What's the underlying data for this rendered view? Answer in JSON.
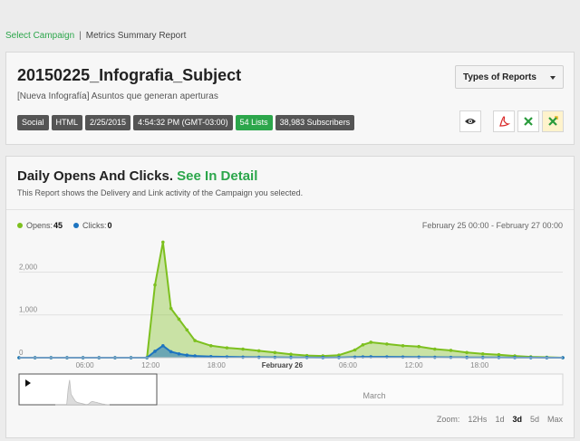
{
  "breadcrumb": {
    "link": "Select Campaign",
    "separator": "|",
    "current": "Metrics Summary Report"
  },
  "campaign": {
    "title": "20150225_Infografia_Subject",
    "subtitle": "[Nueva Infografía] Asuntos que generan aperturas",
    "tags": [
      {
        "label": "Social",
        "style": "dark"
      },
      {
        "label": "HTML",
        "style": "dark"
      },
      {
        "label": "2/25/2015",
        "style": "dark"
      },
      {
        "label": "4:54:32 PM (GMT-03:00)",
        "style": "dark"
      },
      {
        "label": "54 Lists",
        "style": "green"
      },
      {
        "label": "38,983 Subscribers",
        "style": "dark"
      }
    ],
    "reports_button": "Types of Reports",
    "actions": [
      {
        "icon": "eye-icon"
      },
      {
        "icon": "pdf-icon"
      },
      {
        "icon": "excel-icon"
      },
      {
        "icon": "excel-yellow-icon"
      }
    ]
  },
  "chart_section": {
    "title": "Daily Opens And Clicks.",
    "detail_link": "See In Detail",
    "description": "This Report shows the Delivery and Link activity of the Campaign you selected.",
    "date_range": "February 25 00:00 - February 27 00:00",
    "legend": [
      {
        "label": "Opens:",
        "value": "45",
        "color": "#7dc01f"
      },
      {
        "label": "Clicks:",
        "value": "0",
        "color": "#1d74c0"
      }
    ],
    "navigator_label": "March",
    "zoom_label": "Zoom:",
    "zoom_options": [
      "12Hs",
      "1d",
      "3d",
      "5d",
      "Max"
    ],
    "zoom_active": "3d"
  },
  "chart_data": {
    "type": "area",
    "y_ticks": [
      "0",
      "1,000",
      "2,000"
    ],
    "ylim": [
      0,
      2750
    ],
    "x_ticks": [
      "06:00",
      "12:00",
      "18:00",
      "February 26",
      "06:00",
      "12:00",
      "18:00"
    ],
    "x": [
      0,
      2,
      4,
      6,
      8,
      10,
      12,
      14,
      16,
      17,
      18,
      19,
      20,
      21,
      22,
      24,
      26,
      28,
      30,
      32,
      34,
      36,
      38,
      40,
      42,
      43,
      44,
      46,
      48,
      50,
      52,
      54,
      56,
      58,
      60,
      62,
      64,
      66,
      68
    ],
    "series": [
      {
        "name": "Opens",
        "color": "#7dc01f",
        "values": [
          0,
          0,
          0,
          0,
          0,
          0,
          0,
          0,
          0,
          1700,
          2700,
          1150,
          900,
          650,
          400,
          280,
          230,
          200,
          160,
          120,
          80,
          50,
          40,
          60,
          180,
          300,
          360,
          320,
          280,
          260,
          200,
          170,
          120,
          90,
          70,
          40,
          20,
          10,
          0
        ]
      },
      {
        "name": "Clicks",
        "color": "#1d74c0",
        "values": [
          0,
          0,
          0,
          0,
          0,
          0,
          0,
          0,
          0,
          150,
          280,
          140,
          90,
          60,
          40,
          25,
          18,
          12,
          10,
          8,
          6,
          4,
          3,
          5,
          12,
          18,
          20,
          18,
          15,
          12,
          10,
          8,
          6,
          5,
          4,
          3,
          2,
          1,
          0
        ]
      }
    ]
  }
}
